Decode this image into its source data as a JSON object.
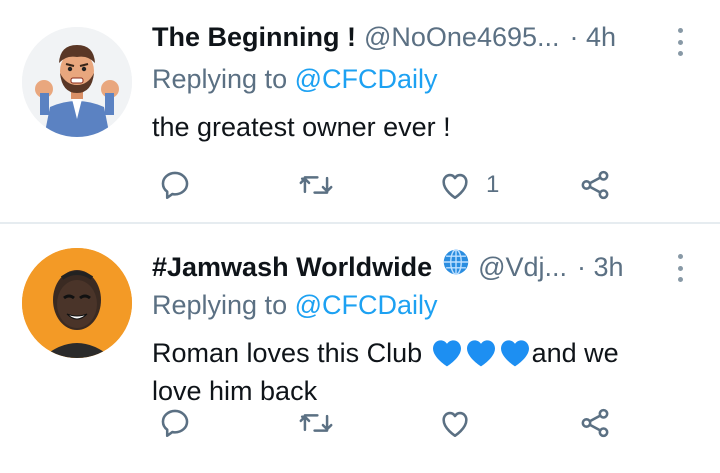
{
  "tweets": [
    {
      "name": "The Beginning !",
      "handle": "@NoOne4695...",
      "time": "· 4h",
      "replying_prefix": "Replying to ",
      "replying_to": "@CFCDaily",
      "text": "the greatest owner ever !",
      "reply_count": "",
      "retweet_count": "",
      "like_count": "1"
    },
    {
      "name": "#Jamwash Worldwide",
      "handle": "@Vdj...",
      "time": "· 3h",
      "replying_prefix": "Replying to ",
      "replying_to": "@CFCDaily",
      "text_start": "Roman loves this Club ",
      "text_end": "and we love him back",
      "emoji": [
        "blue-heart",
        "blue-heart",
        "blue-heart"
      ],
      "name_emoji": "globe",
      "like_count": ""
    }
  ],
  "colors": {
    "accent": "#1da1f2",
    "secondary_text": "#5b7083",
    "primary_text": "#0f1419",
    "divider": "#e6ecf0",
    "heart_blue": "#1d8ff2"
  },
  "icons": [
    "reply-icon",
    "retweet-icon",
    "like-icon",
    "share-icon",
    "more-icon"
  ]
}
